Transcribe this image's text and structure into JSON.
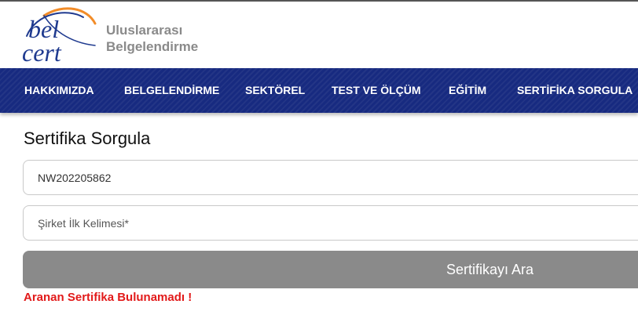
{
  "brand": {
    "logo_top": "bel",
    "logo_bottom": "cert",
    "line1": "Uluslararası",
    "line2": "Belgelendirme"
  },
  "nav": {
    "items": [
      "HAKKIMIZDA",
      "BELGELENDİRME",
      "SEKTÖREL",
      "TEST VE ÖLÇÜM",
      "EĞİTİM",
      "SERTİFİKA SORGULA"
    ]
  },
  "form": {
    "title": "Sertifika Sorgula",
    "certificate_number_value": "NW202205862",
    "company_word_placeholder": "Şirket İlk Kelimesi*",
    "search_button_label": "Sertifikayı Ara",
    "error_message": "Aranan Sertifika Bulunamadı !"
  },
  "colors": {
    "nav_background": "#172a80",
    "logo_blue": "#1f3a8f",
    "logo_orange": "#f28c28",
    "button_gray": "#8a8a8a",
    "error_red": "#e21a1a"
  }
}
